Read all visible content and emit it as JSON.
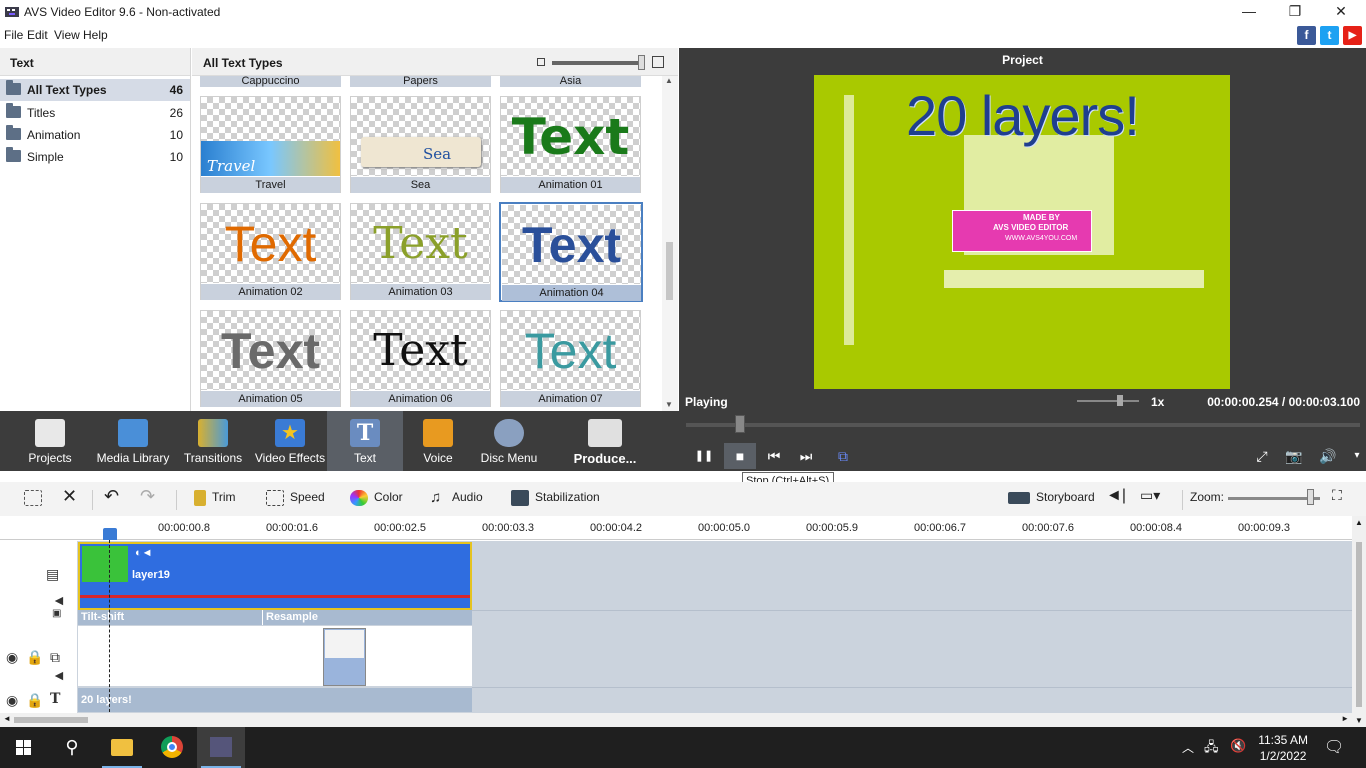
{
  "window": {
    "title": "AVS Video Editor 9.6 - Non-activated",
    "controls": [
      "—",
      "❐",
      "✕"
    ]
  },
  "menu": [
    "File",
    "Edit",
    "View",
    "Help"
  ],
  "social": [
    {
      "name": "facebook",
      "glyph": "f",
      "color": "#3b5998"
    },
    {
      "name": "twitter",
      "glyph": "t",
      "color": "#1da1f2"
    },
    {
      "name": "youtube",
      "glyph": "▶",
      "color": "#e62117"
    }
  ],
  "categories": {
    "header": "Text",
    "items": [
      {
        "label": "All Text Types",
        "count": "46",
        "selected": true
      },
      {
        "label": "Titles",
        "count": "26"
      },
      {
        "label": "Animation",
        "count": "10"
      },
      {
        "label": "Simple",
        "count": "10"
      }
    ]
  },
  "gallery": {
    "header": "All Text Types",
    "top_captions": [
      "Cappuccino",
      "Papers",
      "Asia"
    ],
    "items": [
      {
        "caption": "Travel",
        "preview": "Travel"
      },
      {
        "caption": "Sea",
        "preview": "Sea"
      },
      {
        "caption": "Animation 01",
        "preview": "Text",
        "color": "#1a7a1a"
      },
      {
        "caption": "Animation 02",
        "preview": "Text",
        "color": "#e06a00"
      },
      {
        "caption": "Animation 03",
        "preview": "Text",
        "color": "#8ba02a"
      },
      {
        "caption": "Animation 04",
        "preview": "Text",
        "color": "#2a4f9a",
        "selected": true
      },
      {
        "caption": "Animation 05",
        "preview": "Text",
        "color": "#6a6a6a"
      },
      {
        "caption": "Animation 06",
        "preview": "Text",
        "color": "#111111"
      },
      {
        "caption": "Animation 07",
        "preview": "Text",
        "color": "#3a9aa0"
      }
    ]
  },
  "preview": {
    "title": "Project",
    "overlay_text": "20 layers!",
    "badge_lines": [
      "MADE BY",
      "AVS VIDEO EDITOR",
      "WWW.AVS4YOU.COM"
    ],
    "status": "Playing",
    "speed": "1x",
    "current_time": "00:00:00.254",
    "separator": "/",
    "total_time": "00:00:03.100",
    "playback_position": 0.08
  },
  "toolbar": [
    {
      "label": "Projects",
      "icon": "clapper-icon",
      "color": "#e8e8e8"
    },
    {
      "label": "Media Library",
      "icon": "film-icon",
      "color": "#4a8fd8"
    },
    {
      "label": "Transitions",
      "icon": "transition-icon",
      "color": "#d8b030"
    },
    {
      "label": "Video Effects",
      "icon": "star-icon",
      "color": "#3a7bd5"
    },
    {
      "label": "Text",
      "icon": "text-icon",
      "color": "#6a8cc0",
      "selected": true
    },
    {
      "label": "Voice",
      "icon": "mic-icon",
      "color": "#e89a20"
    },
    {
      "label": "Disc Menu",
      "icon": "disc-icon",
      "color": "#8aa0c0"
    },
    {
      "label": "Produce...",
      "icon": "produce-icon",
      "color": "#e0e0e0"
    }
  ],
  "player": {
    "buttons": [
      {
        "name": "pause-button",
        "glyph": "❚❚"
      },
      {
        "name": "stop-button",
        "glyph": "■",
        "selected": true
      },
      {
        "name": "prev-button",
        "glyph": "⏮"
      },
      {
        "name": "next-button",
        "glyph": "⏭"
      },
      {
        "name": "frame-button",
        "glyph": "⧉"
      }
    ],
    "right": [
      "⤢",
      "📷",
      "🔊"
    ],
    "tooltip": "Stop (Ctrl+Alt+S)"
  },
  "edit_tools": [
    {
      "label": "Trim"
    },
    {
      "label": "Speed"
    },
    {
      "label": "Color"
    },
    {
      "label": "Audio"
    },
    {
      "label": "Stabilization"
    }
  ],
  "edit_right": {
    "storyboard": "Storyboard",
    "zoom": "Zoom:"
  },
  "ruler": [
    "00:00:00.8",
    "00:00:01.6",
    "00:00:02.5",
    "00:00:03.3",
    "00:00:04.2",
    "00:00:05.0",
    "00:00:05.9",
    "00:00:06.7",
    "00:00:07.6",
    "00:00:08.4",
    "00:00:09.3"
  ],
  "timeline": {
    "clip_name": "layer19",
    "effects": [
      "Tilt-shift",
      "Resample"
    ],
    "text_clip": "20 layers!"
  },
  "taskbar": {
    "time": "11:35 AM",
    "date": "1/2/2022"
  }
}
